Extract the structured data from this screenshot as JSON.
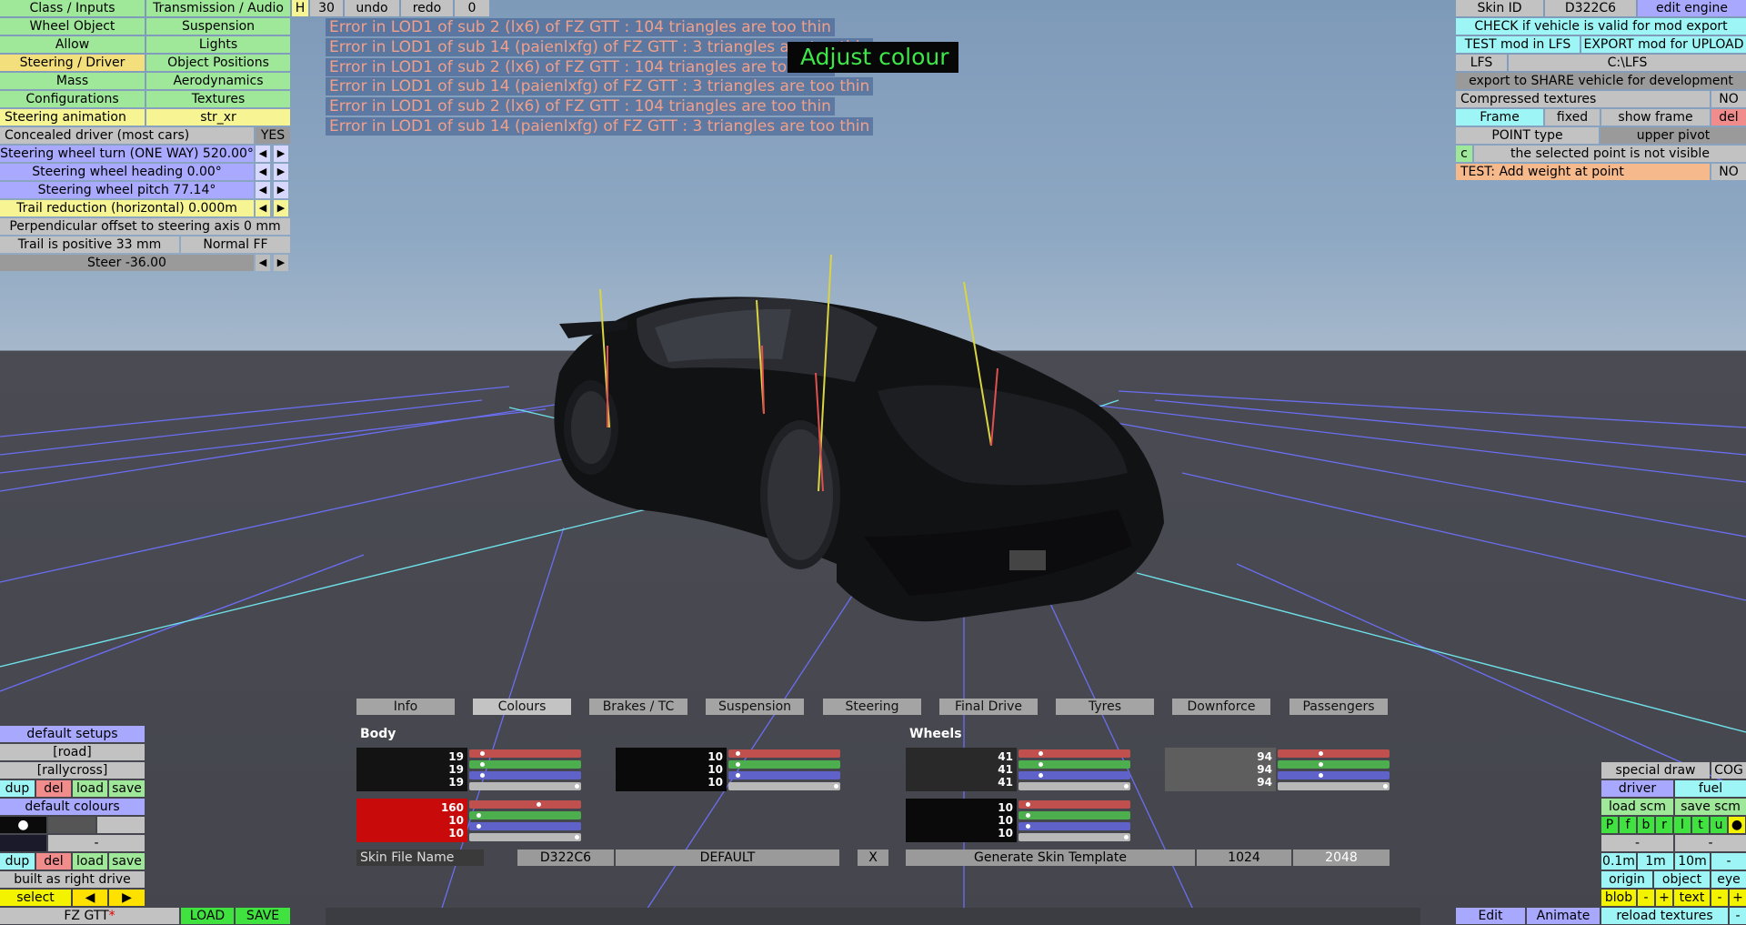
{
  "left_menu": [
    [
      "Class / Inputs",
      "Transmission / Audio"
    ],
    [
      "Wheel Object",
      "Suspension"
    ],
    [
      "Allow",
      "Lights"
    ],
    [
      "Steering / Driver",
      "Object Positions"
    ],
    [
      "Mass",
      "Aerodynamics"
    ],
    [
      "Configurations",
      "Textures"
    ]
  ],
  "steering_animation": {
    "label": "Steering animation",
    "value": "str_xr"
  },
  "concealed_driver": {
    "label": "Concealed driver (most cars)",
    "value": "YES"
  },
  "params": [
    "Steering wheel turn (ONE WAY) 520.00°",
    "Steering wheel heading 0.00°",
    "Steering wheel pitch 77.14°",
    "Trail reduction (horizontal) 0.000m"
  ],
  "perp_offset": "Perpendicular offset to steering axis 0 mm",
  "trail": {
    "label": "Trail is positive 33 mm",
    "mode": "Normal FF"
  },
  "steer": "Steer -36.00",
  "arrows": {
    "left": "◀",
    "right": "▶"
  },
  "toolbar": {
    "h": "H",
    "num": "30",
    "undo": "undo",
    "redo": "redo",
    "zero": "0"
  },
  "errors": [
    "Error in LOD1 of sub 2 (lx6) of FZ GTT : 104 triangles are too thin",
    "Error in LOD1 of sub 14 (paienlxfg) of FZ GTT : 3 triangles are too thin",
    "Error in LOD1 of sub 2 (lx6) of FZ GTT : 104 triangles are too thin",
    "Error in LOD1 of sub 14 (paienlxfg) of FZ GTT : 3 triangles are too thin",
    "Error in LOD1 of sub 2 (lx6) of FZ GTT : 104 triangles are too thin",
    "Error in LOD1 of sub 14 (paienlxfg) of FZ GTT : 3 triangles are too thin"
  ],
  "adjust_colour": "Adjust colour",
  "right_panel": {
    "skin_id_label": "Skin ID",
    "skin_id": "D322C6",
    "edit_engine": "edit engine",
    "check": "CHECK if vehicle is valid for mod export",
    "test_mod": "TEST mod in LFS",
    "export_mod": "EXPORT mod for UPLOAD",
    "lfs": "LFS",
    "lfs_path": "C:\\LFS",
    "export_share": "export to SHARE vehicle for development",
    "compressed": "Compressed textures",
    "compressed_val": "NO",
    "frame": "Frame",
    "fixed": "fixed",
    "show_frame": "show frame",
    "del": "del",
    "point_type": "POINT type",
    "upper_pivot": "upper pivot",
    "c": "c",
    "not_visible": "the selected point is not visible",
    "test_weight": "TEST: Add weight at point",
    "test_weight_val": "NO"
  },
  "tabs": [
    "Info",
    "Colours",
    "Brakes / TC",
    "Suspension",
    "Steering",
    "Final Drive",
    "Tyres",
    "Downforce",
    "Passengers"
  ],
  "active_tab": "Colours",
  "colours": {
    "body_label": "Body",
    "wheels_label": "Wheels",
    "swatches": [
      {
        "name": "body-1",
        "rgb": [
          19,
          19,
          19
        ],
        "hex": "#131313"
      },
      {
        "name": "body-2",
        "rgb": [
          10,
          10,
          10
        ],
        "hex": "#0a0a0a"
      },
      {
        "name": "body-3",
        "rgb": [
          160,
          10,
          10
        ],
        "hex": "#c80a0a"
      },
      {
        "name": "wheels-1",
        "rgb": [
          41,
          41,
          41
        ],
        "hex": "#292929"
      },
      {
        "name": "wheels-2",
        "rgb": [
          94,
          94,
          94
        ],
        "hex": "#5e5e5e"
      },
      {
        "name": "wheels-3",
        "rgb": [
          10,
          10,
          10
        ],
        "hex": "#0a0a0a"
      }
    ]
  },
  "skin": {
    "file_name": "Skin File Name",
    "id": "D322C6",
    "default": "DEFAULT",
    "x": "X",
    "generate": "Generate Skin Template",
    "res1": "1024",
    "res2": "2048"
  },
  "bottom_left": {
    "default_setups": "default setups",
    "road": "[road]",
    "rallycross": "[rallycross]",
    "dup": "dup",
    "del": "del",
    "load": "load",
    "save": "save",
    "default_colours": "default colours",
    "dash": "-",
    "built_as": "built as right drive",
    "select": "select",
    "car_name": "FZ GTT",
    "modified": "*",
    "LOAD": "LOAD",
    "SAVE": "SAVE"
  },
  "bottom_right": {
    "special_draw": "special draw",
    "cog": "COG",
    "driver": "driver",
    "fuel": "fuel",
    "load_scm": "load scm",
    "save_scm": "save scm",
    "letters": [
      "P",
      "f",
      "b",
      "r",
      "l",
      "t",
      "u",
      "●"
    ],
    "dash": "-",
    "m01": "0.1m",
    "m1": "1m",
    "m10": "10m",
    "origin": "origin",
    "object": "object",
    "eye": "eye",
    "blob": "blob",
    "minus": "-",
    "plus": "+",
    "text": "text",
    "edit": "Edit",
    "animate": "Animate",
    "reload": "reload textures"
  }
}
